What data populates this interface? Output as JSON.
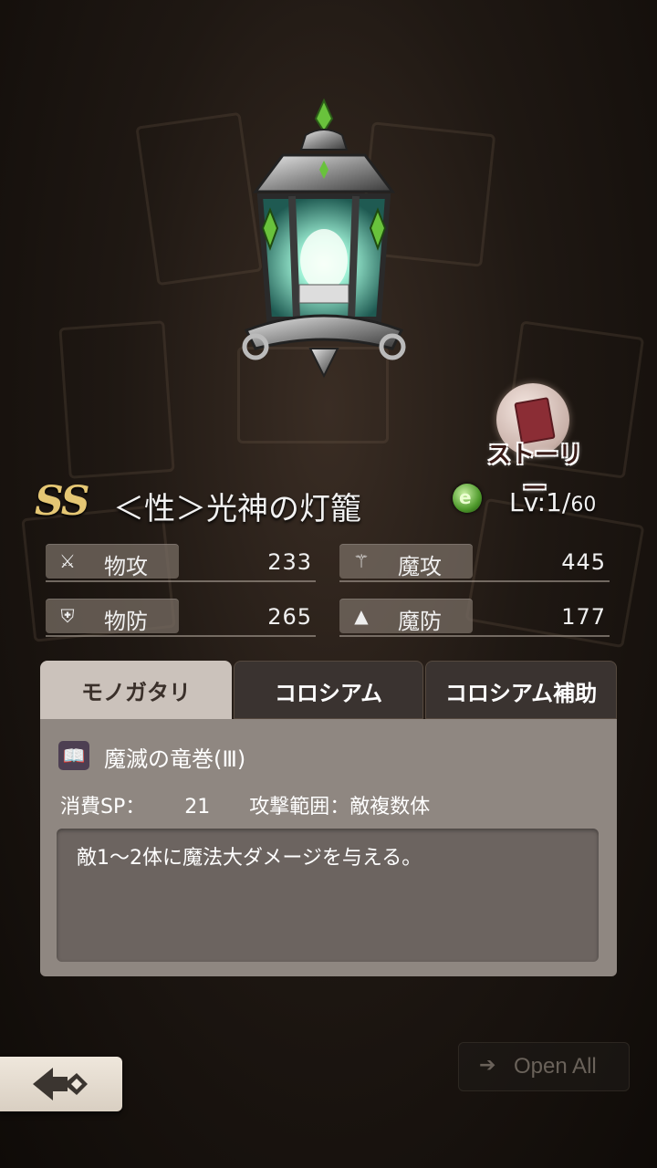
{
  "item": {
    "rank": "SS",
    "name": "＜性＞光神の灯籠",
    "level_prefix": "Lv:1/",
    "level_max": "60",
    "element_icon": "green-element-orb-icon",
    "story_label": "ストーリー"
  },
  "stats": {
    "phys_atk": {
      "label": "物攻",
      "value": "233",
      "icon": "sword-icon"
    },
    "mag_atk": {
      "label": "魔攻",
      "value": "445",
      "icon": "wand-icon"
    },
    "phys_def": {
      "label": "物防",
      "value": "265",
      "icon": "shield-icon"
    },
    "mag_def": {
      "label": "魔防",
      "value": "177",
      "icon": "witch-hat-icon"
    }
  },
  "tabs": [
    {
      "label": "モノガタリ",
      "active": true
    },
    {
      "label": "コロシアム",
      "active": false
    },
    {
      "label": "コロシアム補助",
      "active": false
    }
  ],
  "skill": {
    "icon": "book-icon",
    "name": "魔滅の竜巻(Ⅲ)",
    "sp_label": "消費SP：",
    "sp_value": "21",
    "range": "攻撃範囲：敵複数体",
    "description": "敵1～2体に魔法大ダメージを与える。"
  },
  "controls": {
    "open_all": "Open All",
    "back_icon": "back-arrow-icon"
  },
  "colors": {
    "rank_gold": "#e5c774",
    "active_tab": "#cbc2bb",
    "panel": "#8f8781"
  }
}
